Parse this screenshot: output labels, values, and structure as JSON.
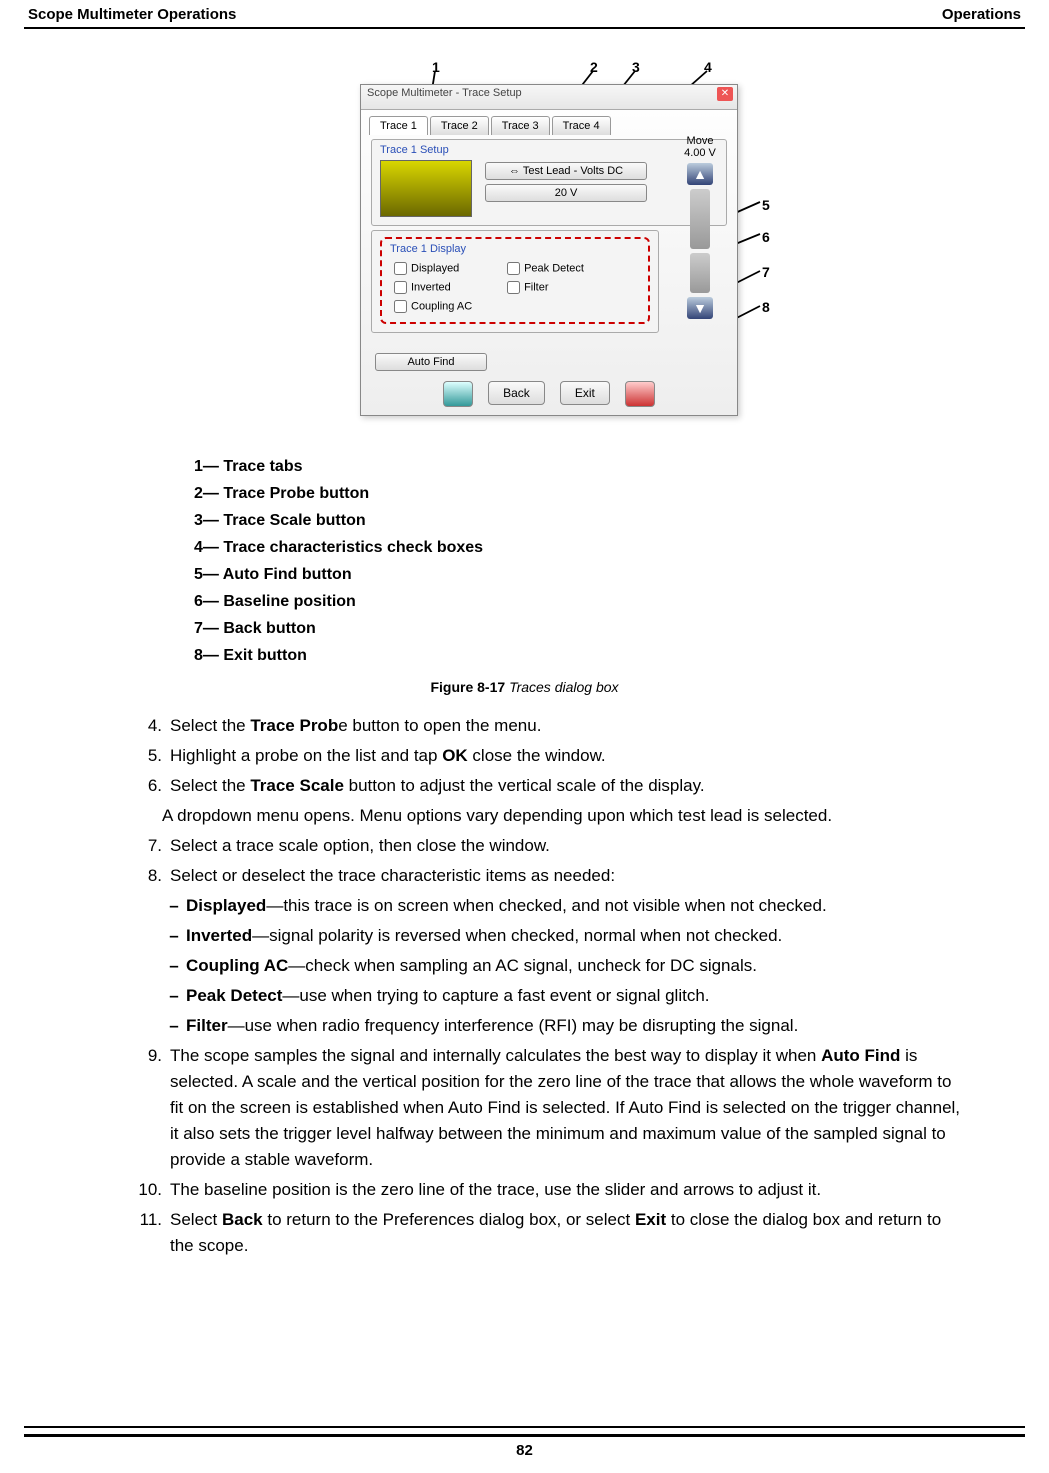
{
  "page": {
    "header_left": "Scope Multimeter Operations",
    "header_right": "Operations",
    "number": "82"
  },
  "callouts": {
    "c1": "1",
    "c2": "2",
    "c3": "3",
    "c4": "4",
    "c5": "5",
    "c6": "6",
    "c7": "7",
    "c8": "8"
  },
  "dialog": {
    "title": "Scope Multimeter - Trace Setup",
    "tabs": [
      "Trace 1",
      "Trace 2",
      "Trace 3",
      "Trace 4"
    ],
    "group1_title": "Trace 1 Setup",
    "probe_btn": "Test Lead - Volts DC",
    "scale_btn": "20 V",
    "move_label": "Move",
    "move_value": "4.00 V",
    "display_title": "Trace 1 Display",
    "chk_displayed": "Displayed",
    "chk_inverted": "Inverted",
    "chk_coupling": "Coupling AC",
    "chk_peak": "Peak Detect",
    "chk_filter": "Filter",
    "auto_find": "Auto Find",
    "back": "Back",
    "exit": "Exit"
  },
  "legend": [
    "1— Trace tabs",
    "2— Trace Probe button",
    "3— Trace Scale button",
    "4— Trace characteristics check boxes",
    "5— Auto Find button",
    "6— Baseline position",
    "7— Back button",
    "8— Exit button"
  ],
  "caption_label": "Figure 8-17",
  "caption_text": "Traces dialog box",
  "steps": {
    "s4_pre": "Select the ",
    "s4_b": "Trace Prob",
    "s4_post": "e button to open the menu.",
    "s5_pre": "Highlight a probe on the list and tap ",
    "s5_b": "OK",
    "s5_post": " close the window.",
    "s6_pre": "Select the ",
    "s6_b": "Trace Scale",
    "s6_post": " button to adjust the vertical scale of the display.",
    "s6_note": "A dropdown menu opens. Menu options vary depending upon which test lead is selected.",
    "s7": "Select a trace scale option, then close the window.",
    "s8": "Select or deselect the trace characteristic items as needed:",
    "sub_displayed_b": "Displayed",
    "sub_displayed": "—this trace is on screen when checked, and not visible when not checked.",
    "sub_inverted_b": "Inverted",
    "sub_inverted": "—signal polarity is reversed when checked, normal when not checked.",
    "sub_coupling_b": "Coupling AC",
    "sub_coupling": "—check when sampling an AC signal, uncheck for DC signals.",
    "sub_peak_b": "Peak Detect",
    "sub_peak": "—use when trying to capture a fast event or signal glitch.",
    "sub_filter_b": "Filter",
    "sub_filter": "—use when radio frequency interference (RFI) may be disrupting the signal.",
    "s9_pre": "The scope samples the signal and internally calculates the best way to display it when ",
    "s9_b": "Auto Find",
    "s9_post": " is selected. A scale and the vertical position for the zero line of the trace that allows the whole waveform to fit on the screen is established when Auto Find is selected. If Auto Find is selected on the trigger channel, it also sets the trigger level halfway between the minimum and maximum value of the sampled signal to provide a stable waveform.",
    "s10": "The baseline position is the zero line of the trace, use the slider and arrows to adjust it.",
    "s11_pre": "Select ",
    "s11_b1": "Back",
    "s11_mid": " to return to the Preferences dialog box, or select ",
    "s11_b2": "Exit",
    "s11_post": " to close the dialog box and return to the scope."
  }
}
